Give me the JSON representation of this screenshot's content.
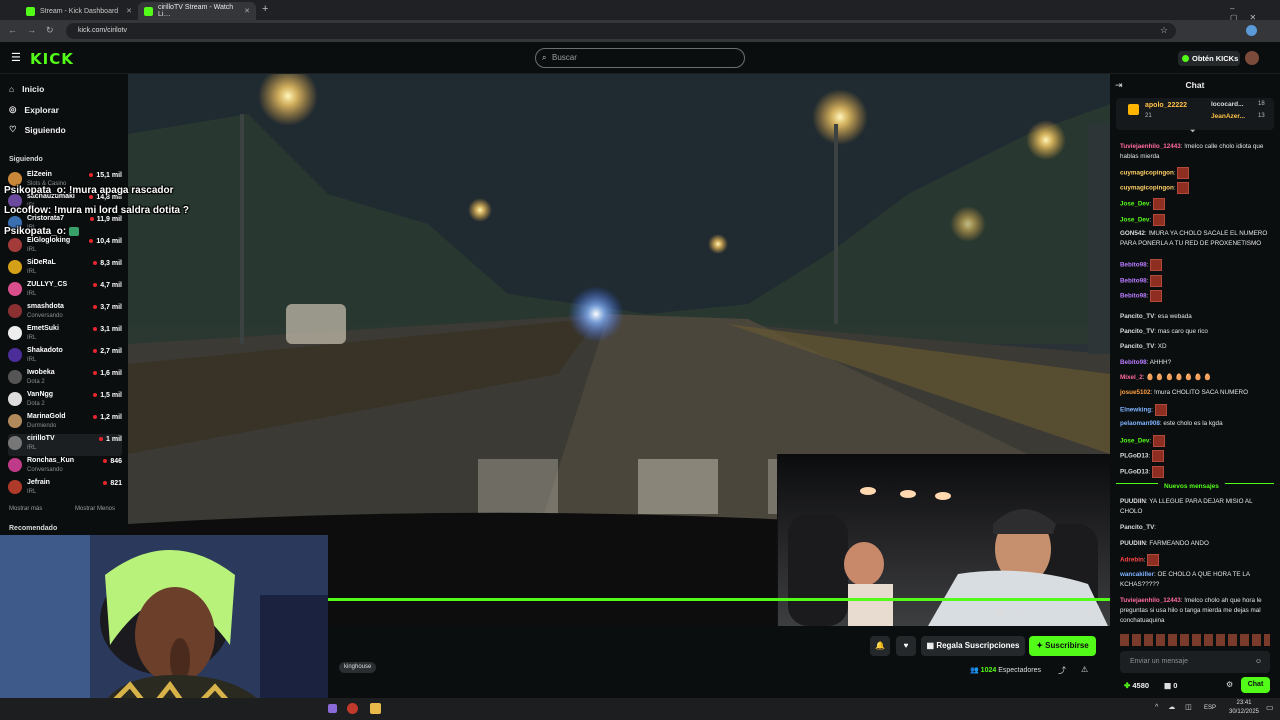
{
  "browser": {
    "tabs": [
      {
        "title": "Stream - Kick Dashboard"
      },
      {
        "title": "cirilloTV Stream - Watch Li…"
      }
    ],
    "url": "kick.com/cirilotv"
  },
  "topnav": {
    "logo": "KICK",
    "search_placeholder": "Buscar",
    "get_kicks": "Obtén KICKs"
  },
  "sidebar": {
    "nav": [
      {
        "label": "Inicio",
        "icon": "home-icon"
      },
      {
        "label": "Explorar",
        "icon": "compass-icon"
      },
      {
        "label": "Siguiendo",
        "icon": "heart-icon"
      }
    ],
    "following_title": "Siguiendo",
    "channels": [
      {
        "name": "ElZeein",
        "category": "Slots & Casino",
        "viewers": "15,1 mil",
        "color": "#c9873a"
      },
      {
        "name": "sachauzumaki",
        "category": "IRL",
        "viewers": "14,8 mil",
        "color": "#6b4a9e"
      },
      {
        "name": "Cristorata7",
        "category": "IRL",
        "viewers": "11,9 mil",
        "color": "#3a6fb0"
      },
      {
        "name": "ElGlogloking",
        "category": "IRL",
        "viewers": "10,4 mil",
        "color": "#a33b3b"
      },
      {
        "name": "SiDeRaL",
        "category": "IRL",
        "viewers": "8,3 mil",
        "color": "#d4a017"
      },
      {
        "name": "ZULLYY_CS",
        "category": "IRL",
        "viewers": "4,7 mil",
        "color": "#d94f8c"
      },
      {
        "name": "smashdota",
        "category": "Conversando",
        "viewers": "3,7 mil",
        "color": "#8a3030"
      },
      {
        "name": "EmetSuki",
        "category": "IRL",
        "viewers": "3,1 mil",
        "color": "#eeeeee"
      },
      {
        "name": "Shakadoto",
        "category": "IRL",
        "viewers": "2,7 mil",
        "color": "#4b2e9a"
      },
      {
        "name": "Iwobeka",
        "category": "Dota 2",
        "viewers": "1,6 mil",
        "color": "#555555"
      },
      {
        "name": "VanNgg",
        "category": "Dota 2",
        "viewers": "1,5 mil",
        "color": "#dddddd"
      },
      {
        "name": "MarinaGold",
        "category": "Durmiendo",
        "viewers": "1,2 mil",
        "color": "#b08a5a"
      },
      {
        "name": "cirilloTV",
        "category": "IRL",
        "viewers": "1 mil",
        "color": "#777777",
        "active": true
      },
      {
        "name": "Ronchas_Kun",
        "category": "Conversando",
        "viewers": "846",
        "color": "#c03a8a"
      },
      {
        "name": "Jefrain",
        "category": "IRL",
        "viewers": "821",
        "color": "#b03a2a"
      }
    ],
    "show_more": "Mostrar más",
    "show_less": "Mostrar Menos",
    "recommended": "Recomendado"
  },
  "overlay_chat": [
    {
      "text": "Psikopata_o: !mura apaga rascador"
    },
    {
      "text": "Locoflow: !mura mi lord saldra dotita ?"
    },
    {
      "text": "Psikopata_o:"
    }
  ],
  "channel_bar": {
    "tag": "kinghouse",
    "gift_subs": "Regala Suscripciones",
    "subscribe": "Suscribirse",
    "viewers_count": "1024",
    "viewers_label": "Espectadores"
  },
  "chat": {
    "title": "Chat",
    "leaderboard": [
      {
        "name": "apolo_22222",
        "value": "21"
      },
      {
        "name": "lococard...",
        "value": "18"
      },
      {
        "name": "JeanAzer...",
        "value": "13"
      }
    ],
    "messages": [
      {
        "user": "Tuviejaenhilo_12443",
        "color": "#ff6b9d",
        "text": "!melco calle cholo idiota que hablas mierda"
      },
      {
        "user": "cuymagicopingon",
        "color": "#ffd166",
        "text": "",
        "emote": true
      },
      {
        "user": "cuymagicopingon",
        "color": "#ffd166",
        "text": "",
        "emote": true
      },
      {
        "user": "Jose_Dev",
        "color": "#53fc18",
        "text": "",
        "emote": true
      },
      {
        "user": "Jose_Dev",
        "color": "#53fc18",
        "text": "",
        "emote": true
      },
      {
        "user": "GON542",
        "color": "#dcdcdc",
        "text": "!MURA YA CHOLO SACALE EL NUMERO PARA PONERLA A TU RED DE PROXENETISMO"
      },
      {
        "user": "Bebito98",
        "color": "#b77cff",
        "text": "",
        "emote": true
      },
      {
        "user": "Bebito98",
        "color": "#b77cff",
        "text": "",
        "emote": true
      },
      {
        "user": "Bebito98",
        "color": "#b77cff",
        "text": "",
        "emote": true
      },
      {
        "user": "Pancito_TV",
        "color": "#dcdcdc",
        "text": "esa webada"
      },
      {
        "user": "Pancito_TV",
        "color": "#dcdcdc",
        "text": "mas caro que rico"
      },
      {
        "user": "Pancito_TV",
        "color": "#dcdcdc",
        "text": "XD"
      },
      {
        "user": "Bebito98",
        "color": "#b77cff",
        "text": "AHHH?"
      },
      {
        "user": "Mixel_2",
        "color": "#ff6b9d",
        "text": "🥚 🥚 🥚 🥚 🥚 🥚 🥚"
      },
      {
        "user": "josue5102",
        "color": "#ff9f43",
        "text": "!mura CHOLITO SACA NUMERO"
      },
      {
        "user": "Elnewking",
        "color": "#7fb3ff",
        "text": "",
        "emote": true
      },
      {
        "user": "pelaoman908",
        "color": "#7fb3ff",
        "text": "este cholo es la kgda"
      },
      {
        "user": "Jose_Dev",
        "color": "#53fc18",
        "text": "",
        "emote": true
      },
      {
        "user": "PLGoD13",
        "color": "#dcdcdc",
        "text": "",
        "emote": true
      },
      {
        "user": "PLGoD13",
        "color": "#dcdcdc",
        "text": "",
        "emote": true
      }
    ],
    "new_messages": "Nuevos mensajes",
    "messages_after": [
      {
        "user": "PUUDIIN",
        "color": "#dcdcdc",
        "text": "YA LLEGUE PARA DEJAR MISIO AL CHOLO"
      },
      {
        "user": "Pancito_TV",
        "color": "#dcdcdc",
        "text": ""
      },
      {
        "user": "PUUDIIN",
        "color": "#dcdcdc",
        "text": "FARMEANDO ANDO"
      },
      {
        "user": "Adrebin",
        "color": "#ff4444",
        "text": "",
        "emote": true
      },
      {
        "user": "wancakiller",
        "color": "#7fb3ff",
        "text": "OE CHOLO A QUE HORA TE LA KCHAS?????"
      },
      {
        "user": "Tuviejaenhilo_12443",
        "color": "#ff6b9d",
        "text": "!melco cholo ah que hora le preguntas si usa hilo o tanga mierda me dejas mal conchatuaquina"
      }
    ],
    "input_placeholder": "Enviar un mensaje",
    "points": "4580",
    "subs": "0",
    "send": "Chat"
  },
  "taskbar": {
    "lang": "ESP",
    "time": "23:41",
    "date": "30/12/2025"
  }
}
